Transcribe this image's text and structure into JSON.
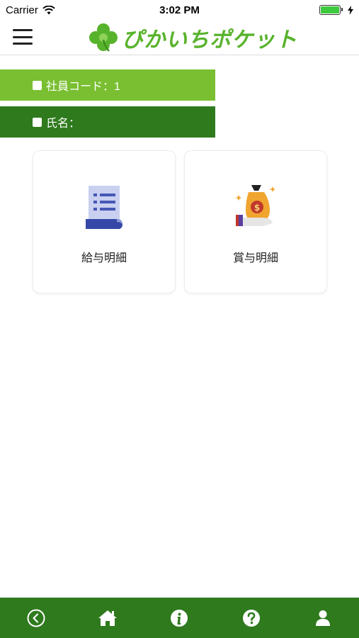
{
  "status_bar": {
    "carrier": "Carrier",
    "time": "3:02 PM",
    "battery_level": 1.0
  },
  "header": {
    "logo_text": "ぴかいちポケット",
    "logo_icon": "clover-icon",
    "menu_icon": "hamburger-icon"
  },
  "info": {
    "employee_code_label": "社員コード：1",
    "name_label": "氏名："
  },
  "cards": {
    "salary": {
      "label": "給与明細",
      "icon": "receipt-icon"
    },
    "bonus": {
      "label": "賞与明細",
      "icon": "money-bag-icon"
    }
  },
  "bottom_nav": {
    "items": [
      {
        "icon": "back-icon"
      },
      {
        "icon": "home-icon"
      },
      {
        "icon": "info-icon"
      },
      {
        "icon": "help-icon"
      },
      {
        "icon": "user-icon"
      }
    ]
  },
  "colors": {
    "light_green": "#79bf31",
    "dark_green": "#2e7a1d",
    "logo_green": "#58b32c"
  }
}
